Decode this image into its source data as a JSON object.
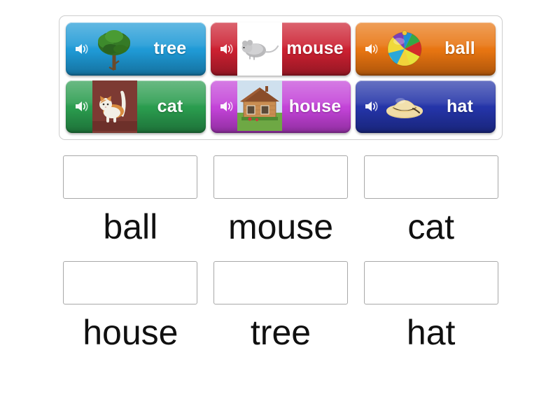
{
  "word_bank": {
    "name": "word-bank",
    "tiles": [
      {
        "word": "tree",
        "color": "#1f9ad6",
        "color_dark": "#1782b7",
        "icon": "speaker-icon",
        "image": "tree-image"
      },
      {
        "word": "mouse",
        "color": "#cc2031",
        "color_dark": "#ab1a29",
        "icon": "speaker-icon",
        "image": "mouse-image"
      },
      {
        "word": "ball",
        "color": "#e87511",
        "color_dark": "#c8620c",
        "icon": "speaker-icon",
        "image": "ball-image"
      },
      {
        "word": "cat",
        "color": "#2a9c4e",
        "color_dark": "#228241",
        "icon": "speaker-icon",
        "image": "cat-image"
      },
      {
        "word": "house",
        "color": "#c343d8",
        "color_dark": "#a635b8",
        "icon": "speaker-icon",
        "image": "house-image"
      },
      {
        "word": "hat",
        "color": "#2434a8",
        "color_dark": "#1c2a8c",
        "icon": "speaker-icon",
        "image": "hat-image"
      }
    ]
  },
  "answers": {
    "name": "answer-slots",
    "slots": [
      {
        "label": "ball",
        "value": ""
      },
      {
        "label": "mouse",
        "value": ""
      },
      {
        "label": "cat",
        "value": ""
      },
      {
        "label": "house",
        "value": ""
      },
      {
        "label": "tree",
        "value": ""
      },
      {
        "label": "hat",
        "value": ""
      }
    ]
  },
  "colors": {
    "page_background": "#ffffff",
    "panel_border": "#cdcdcd",
    "dropzone_border": "#a8a8a8",
    "label_text": "#101010",
    "tile_text": "#ffffff"
  }
}
